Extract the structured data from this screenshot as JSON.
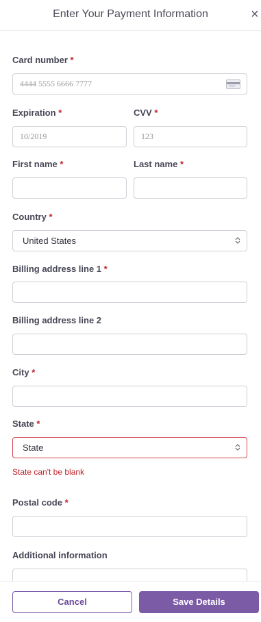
{
  "header": {
    "title": "Enter Your Payment Information",
    "close_label": "×"
  },
  "form": {
    "card_number": {
      "label": "Card number",
      "placeholder": "4444 5555 6666 7777"
    },
    "expiration": {
      "label": "Expiration",
      "placeholder": "10/2019"
    },
    "cvv": {
      "label": "CVV",
      "placeholder": "123"
    },
    "first_name": {
      "label": "First name",
      "value": ""
    },
    "last_name": {
      "label": "Last name",
      "value": ""
    },
    "country": {
      "label": "Country",
      "value": "United States"
    },
    "billing1": {
      "label": "Billing address line 1",
      "value": ""
    },
    "billing2": {
      "label": "Billing address line 2",
      "value": ""
    },
    "city": {
      "label": "City",
      "value": ""
    },
    "state": {
      "label": "State",
      "value": "State",
      "error": "State can't be blank"
    },
    "postal": {
      "label": "Postal code",
      "value": ""
    },
    "additional": {
      "label": "Additional information",
      "value": ""
    }
  },
  "required_mark": "*",
  "footer": {
    "cancel_label": "Cancel",
    "save_label": "Save Details"
  },
  "colors": {
    "accent": "#7b5aa6",
    "error": "#c0222a",
    "border": "#cfcfd8"
  },
  "icons": {
    "card": "credit-card-icon",
    "chevron": "chevron-up-down-icon",
    "close": "close-icon"
  }
}
